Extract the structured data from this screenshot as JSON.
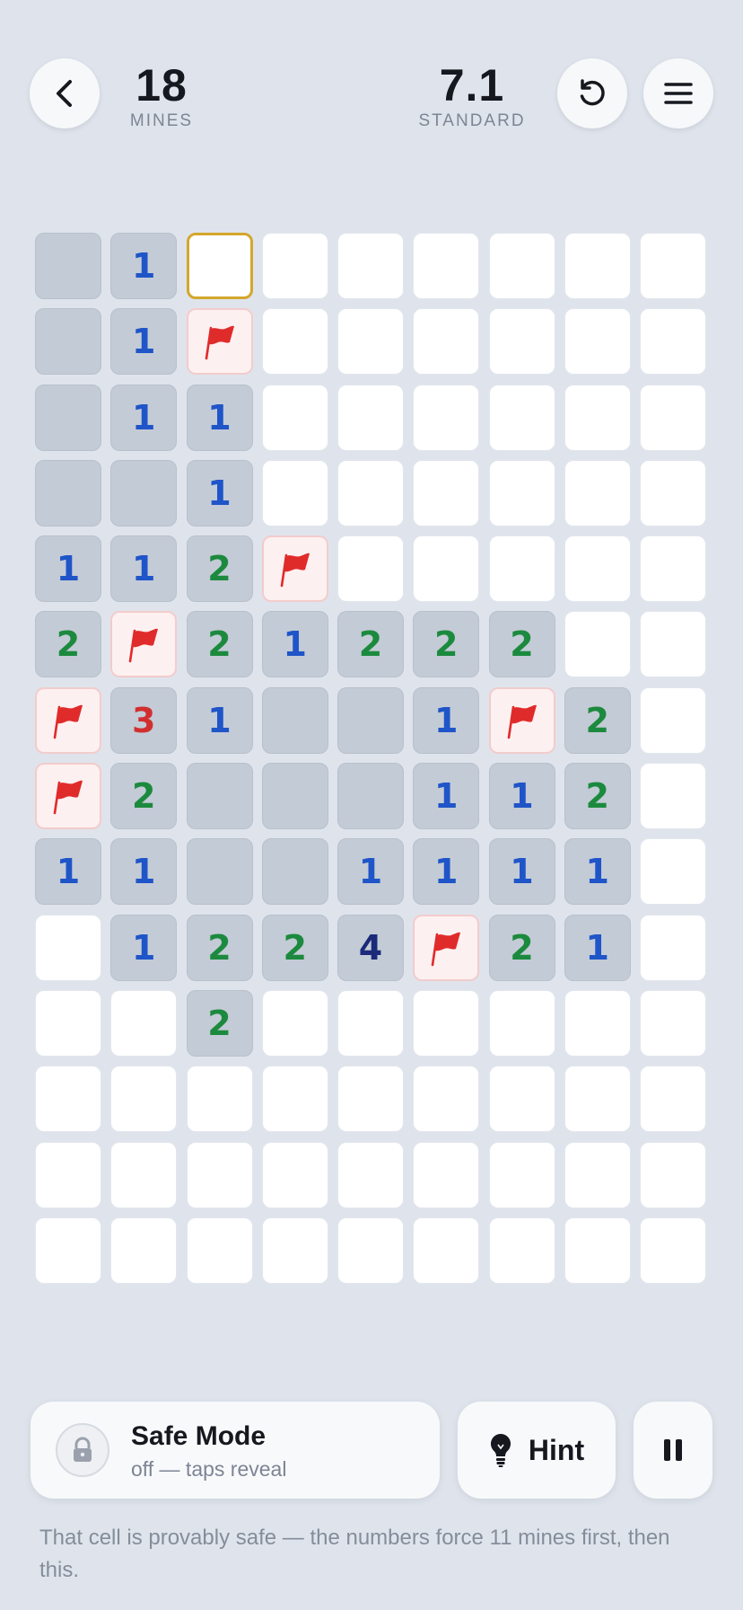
{
  "header": {
    "mines_count": "18",
    "mines_label": "MINES",
    "difficulty_value": "7.1",
    "difficulty_label": "STANDARD"
  },
  "board": {
    "columns": 9,
    "rows": 14,
    "selected": [
      0,
      2
    ],
    "cells": [
      [
        "r",
        "1",
        "u",
        "u",
        "u",
        "u",
        "u",
        "u",
        "u"
      ],
      [
        "r",
        "1",
        "F",
        "u",
        "u",
        "u",
        "u",
        "u",
        "u"
      ],
      [
        "r",
        "1",
        "1",
        "u",
        "u",
        "u",
        "u",
        "u",
        "u"
      ],
      [
        "r",
        "r",
        "1",
        "u",
        "u",
        "u",
        "u",
        "u",
        "u"
      ],
      [
        "1",
        "1",
        "2",
        "F",
        "u",
        "u",
        "u",
        "u",
        "u"
      ],
      [
        "2",
        "F",
        "2",
        "1",
        "2",
        "2",
        "2",
        "u",
        "u"
      ],
      [
        "F",
        "3",
        "1",
        "r",
        "r",
        "1",
        "F",
        "2",
        "u"
      ],
      [
        "F",
        "2",
        "r",
        "r",
        "r",
        "1",
        "1",
        "2",
        "u"
      ],
      [
        "1",
        "1",
        "r",
        "r",
        "1",
        "1",
        "1",
        "1",
        "u"
      ],
      [
        "u",
        "1",
        "2",
        "2",
        "4",
        "F",
        "2",
        "1",
        "u"
      ],
      [
        "u",
        "u",
        "2",
        "u",
        "u",
        "u",
        "u",
        "u",
        "u"
      ],
      [
        "u",
        "u",
        "u",
        "u",
        "u",
        "u",
        "u",
        "u",
        "u"
      ],
      [
        "u",
        "u",
        "u",
        "u",
        "u",
        "u",
        "u",
        "u",
        "u"
      ],
      [
        "u",
        "u",
        "u",
        "u",
        "u",
        "u",
        "u",
        "u",
        "u"
      ]
    ]
  },
  "safe_mode": {
    "title": "Safe Mode",
    "status": "off — taps reveal",
    "icon": "lock-icon"
  },
  "hint": {
    "label": "Hint",
    "icon": "lightbulb-icon"
  },
  "pause": {
    "icon": "pause-icon"
  },
  "message": "That cell is provably safe — the numbers force 11 mines first, then this.",
  "colors": {
    "background": "#dfe4ec",
    "number_1": "#1f55c8",
    "number_2": "#1c8a3e",
    "number_3": "#d12f2f",
    "number_4": "#1b2b7a",
    "flag": "#e02b2b",
    "selection": "#d4a72c"
  }
}
